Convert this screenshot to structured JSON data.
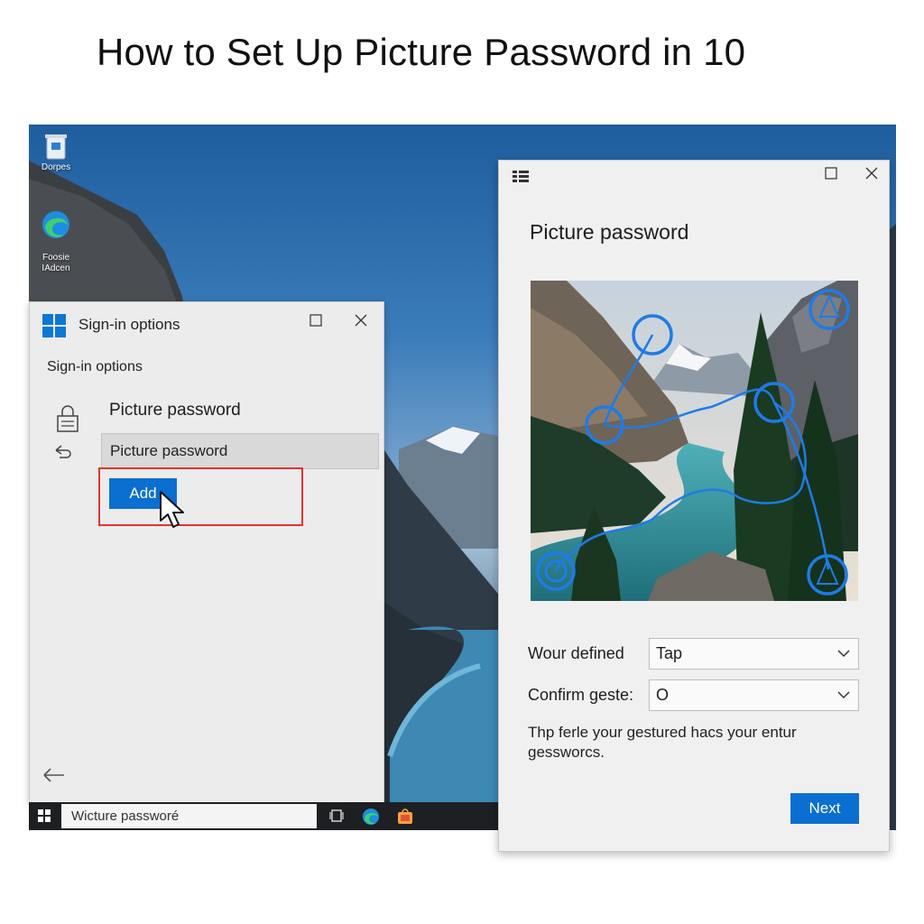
{
  "headline": "How to Set Up Picture Password in 10",
  "desktop": {
    "icons": [
      {
        "label": "Dorpes",
        "icon": "recycle-bin-icon"
      },
      {
        "label": "Foosie\nIAdcen",
        "icon": "edge-icon"
      }
    ]
  },
  "signin_window": {
    "title": "Sign-in options",
    "subtitle": "Sign-in options",
    "section_title": "Picture password",
    "field_text": "Picture password",
    "add_button": "Add",
    "accent": "#0a6fd0",
    "highlight_color": "#e0342f"
  },
  "taskbar": {
    "search_text": "Wicture passworé",
    "icons": [
      "start-icon",
      "task-view-icon",
      "edge-icon",
      "store-icon"
    ]
  },
  "picture_window": {
    "title": "Picture password",
    "gesture_label": "Wour defined",
    "gesture_value": "Tap",
    "confirm_label": "Confirm geste:",
    "confirm_value": "O",
    "help_text": "Thp ferle your gestured hacs your entur gessworcs.",
    "next_button": "Next"
  }
}
